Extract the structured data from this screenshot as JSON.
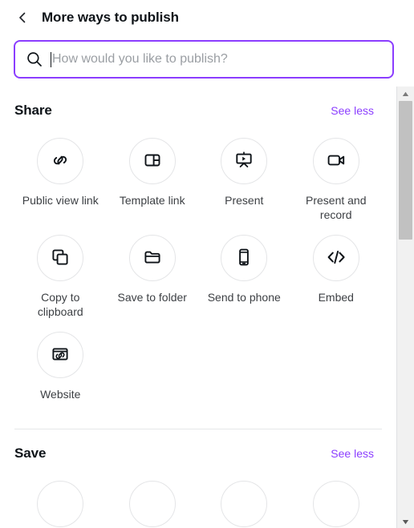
{
  "header": {
    "title": "More ways to publish",
    "back_icon": "chevron-left-icon"
  },
  "search": {
    "value": "",
    "placeholder": "How would you like to publish?",
    "icon": "search-icon",
    "border_color": "#8b3dff"
  },
  "accent_color": "#8b3dff",
  "sections": [
    {
      "title": "Share",
      "toggle_label": "See less",
      "tiles": [
        {
          "label": "Public view link",
          "icon": "link-icon"
        },
        {
          "label": "Template link",
          "icon": "layout-panel-icon"
        },
        {
          "label": "Present",
          "icon": "presentation-play-icon"
        },
        {
          "label": "Present and record",
          "icon": "video-camera-icon"
        },
        {
          "label": "Copy to clipboard",
          "icon": "copy-icon"
        },
        {
          "label": "Save to folder",
          "icon": "folder-icon"
        },
        {
          "label": "Send to phone",
          "icon": "mobile-phone-icon"
        },
        {
          "label": "Embed",
          "icon": "code-brackets-icon"
        },
        {
          "label": "Website",
          "icon": "browser-link-icon"
        }
      ]
    },
    {
      "title": "Save",
      "toggle_label": "See less",
      "tiles": []
    }
  ],
  "scrollbar": {
    "up_arrow": "triangle-up-icon",
    "down_arrow": "triangle-down-icon"
  }
}
